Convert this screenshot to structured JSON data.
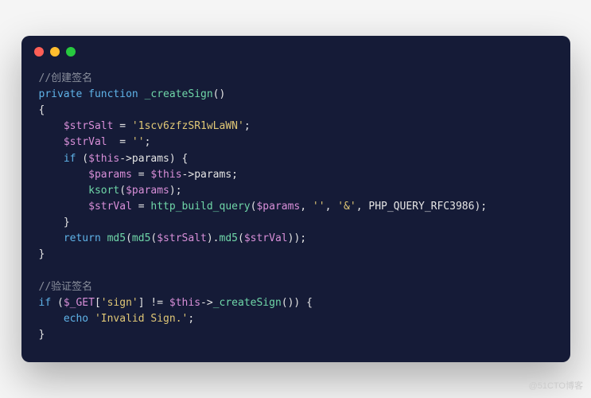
{
  "watermark": "@51CTO博客",
  "code": {
    "comment1": "//创建签名",
    "line2": {
      "kw1": "private",
      "kw2": "function",
      "fn": "_createSign",
      "paren": "()"
    },
    "brace_open": "{",
    "l4": {
      "indent": "    ",
      "var": "$strSalt",
      "assign": " = ",
      "str": "'1scv6zfzSR1wLaWN'",
      "semi": ";"
    },
    "l5": {
      "indent": "    ",
      "var": "$strVal",
      "assign": "  = ",
      "str": "''",
      "semi": ";"
    },
    "l6": {
      "indent": "    ",
      "kw": "if",
      "sp": " (",
      "var": "$this",
      "arrow": "->",
      "prop": "params",
      "close": ") {"
    },
    "l7": {
      "indent": "        ",
      "var": "$params",
      "assign": " = ",
      "var2": "$this",
      "arrow": "->",
      "prop": "params",
      "semi": ";"
    },
    "l8": {
      "indent": "        ",
      "fn": "ksort",
      "open": "(",
      "var": "$params",
      "close": ");"
    },
    "l9": {
      "indent": "        ",
      "var": "$strVal",
      "assign": " = ",
      "fn": "http_build_query",
      "open": "(",
      "v1": "$params",
      "c1": ", ",
      "s1": "''",
      "c2": ", ",
      "s2": "'&'",
      "c3": ", ",
      "const": "PHP_QUERY_RFC3986",
      "close": ");"
    },
    "l10": {
      "indent": "    ",
      "brace": "}"
    },
    "l11": {
      "indent": "    ",
      "kw": "return",
      "sp": " ",
      "fn1": "md5",
      "o1": "(",
      "fn2": "md5",
      "o2": "(",
      "v1": "$strSalt",
      "c1": ").",
      "fn3": "md5",
      "o3": "(",
      "v2": "$strVal",
      "close": "));"
    },
    "brace_close": "}",
    "blank": "",
    "comment2": "//验证签名",
    "l14": {
      "kw": "if",
      "sp": " (",
      "var": "$_GET",
      "br": "[",
      "str": "'sign'",
      "br2": "] != ",
      "var2": "$this",
      "arrow": "->",
      "fn": "_createSign",
      "close": "()) {"
    },
    "l15": {
      "indent": "    ",
      "kw": "echo",
      "sp": " ",
      "str": "'Invalid Sign.'",
      "semi": ";"
    },
    "l16": "}"
  }
}
